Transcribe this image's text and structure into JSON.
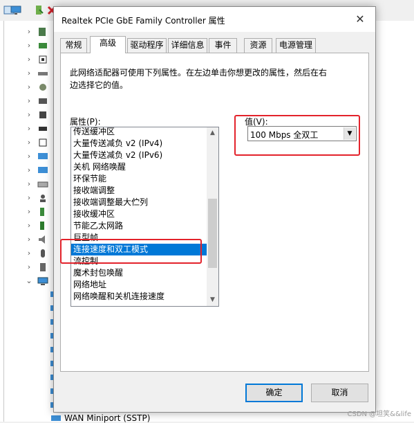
{
  "dialog": {
    "title": "Realtek PCIe GbE Family Controller 属性",
    "close_icon": "close-icon",
    "tabs": [
      {
        "label": "常规",
        "active": false
      },
      {
        "label": "高级",
        "active": true
      },
      {
        "label": "驱动程序",
        "active": false
      },
      {
        "label": "详细信息",
        "active": false
      },
      {
        "label": "事件",
        "active": false
      },
      {
        "label": "资源",
        "active": false
      },
      {
        "label": "电源管理",
        "active": false
      }
    ],
    "description_line1": "此网络适配器可使用下列属性。在左边单击你想更改的属性，然后在右",
    "description_line2": "边选择它的值。",
    "property_label": "属性(P):",
    "value_label": "值(V):",
    "properties": [
      "传送缓冲区",
      "大量传送减负 v2 (IPv4)",
      "大量传送减负 v2 (IPv6)",
      "关机 网络唤醒",
      "环保节能",
      "接收端调整",
      "接收端调整最大伫列",
      "接收缓冲区",
      "节能乙太网路",
      "巨型帧",
      "连接速度和双工模式",
      "流控制",
      "魔术封包唤醒",
      "网络地址",
      "网络唤醒和关机连接速度"
    ],
    "selected_property_index": 10,
    "selected_value": "100 Mbps 全双工",
    "ok_label": "确定",
    "cancel_label": "取消"
  },
  "background": {
    "bottom_device_label": "WAN Miniport (SSTP)"
  },
  "watermark": "CSDN @坦笑&&life",
  "colors": {
    "selection": "#0078d7",
    "highlight_box": "#e3222b"
  }
}
